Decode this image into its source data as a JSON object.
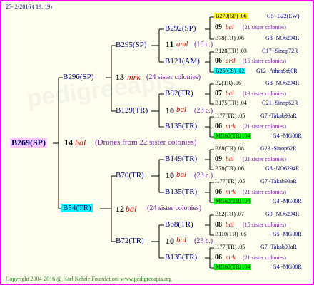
{
  "date": "25- 2-2016 ( 19: 19)",
  "copyright": "Copyright 2004-2016 @ Karl Kehrle Foundation.   www.pedigreeapis.org",
  "colors": {
    "border": "#ff00ff",
    "yellow": "#ffff00",
    "cyan": "#00ffff",
    "green": "#00ff00",
    "pink": "#ffccff"
  },
  "root": {
    "label": "B269(SP)",
    "code": "14",
    "race": "bal",
    "note": "(Drones from 22 sister colonies)"
  },
  "dam": {
    "label": "B296(SP)",
    "code": "13",
    "race": "mrk",
    "note": "(24 sister colonies)",
    "sire": {
      "label": "B295(SP)",
      "code": "11",
      "race": "aml",
      "note": "(16 c.)"
    },
    "dam": {
      "label": "B129(TR)",
      "code": "10",
      "race": "bal",
      "note": "(23 c.)"
    }
  },
  "sire": {
    "label": "B54(TR)",
    "code": "12",
    "race": "bal",
    "note": "(24 sister colonies)",
    "dam": {
      "label": "B70(TR)",
      "code": "10",
      "race": "bal",
      "note": "(23 c.)"
    },
    "sire": {
      "label": "B72(TR)",
      "code": "10",
      "race": "bal",
      "note": "(23 c.)"
    }
  },
  "level3": [
    {
      "label": "B292(SP)"
    },
    {
      "label": "B121(AM)"
    },
    {
      "label": "B82(TR)"
    },
    {
      "label": "B135(TR)"
    },
    {
      "label": "B149(TR)"
    },
    {
      "label": "B135(TR)"
    },
    {
      "label": "B68(TR)"
    },
    {
      "label": "B135(TR)"
    }
  ],
  "leaves": [
    {
      "left": "B270(SP) .06",
      "right": "G5 -B22(EW)"
    },
    {
      "code": "09",
      "race": "bal",
      "note": "(21 sister colonies)"
    },
    {
      "left": "B78(TR) .06",
      "right": "G8 -NO6294R"
    },
    {
      "left": "B128(TR) .03",
      "right": "G17 -Sinop72R"
    },
    {
      "code": "06",
      "race": "aml",
      "note": "(15 sister colonies)"
    },
    {
      "left": "B25(CS) .02",
      "right": "G12 -AthosSt80R"
    },
    {
      "left": "B2(TR) .06",
      "right": "G8 -NO6294R"
    },
    {
      "code": "07",
      "race": "bal",
      "note": "(19 sister colonies)"
    },
    {
      "left": "B175(TR) .04",
      "right": "G21 -Sinop62R"
    },
    {
      "left": "I177(TR) .05",
      "right": "G7 -Takab93aR"
    },
    {
      "code": "06",
      "race": "mrk",
      "note": "(21 sister colonies)"
    },
    {
      "left": "MG60(TR) .04",
      "right": "G4 -MG00R"
    },
    {
      "left": "B88(TR) .08",
      "right": "G23 -Sinop62R"
    },
    {
      "code": "09",
      "race": "bal",
      "note": "(21 sister colonies)"
    },
    {
      "left": "B78(TR) .06",
      "right": "G8 -NO6294R"
    },
    {
      "left": "I177(TR) .05",
      "right": "G7 -Takab93aR"
    },
    {
      "code": "06",
      "race": "mrk",
      "note": "(21 sister colonies)"
    },
    {
      "left": "MG60(TR) .04",
      "right": "G4 -MG00R"
    },
    {
      "left": "B82(TR) .07",
      "right": "G9 -NO6294R"
    },
    {
      "code": "08",
      "race": "bal",
      "note": "(15 sister colonies)"
    },
    {
      "left": "B110(TR) .05",
      "right": "G5 -MG00R"
    },
    {
      "left": "I177(TR) .05",
      "right": "G7 -Takab93aR"
    },
    {
      "code": "06",
      "race": "mrk",
      "note": "(21 sister colonies)"
    },
    {
      "left": "MG60(TR) .04",
      "right": "G4 -MG00R"
    }
  ]
}
